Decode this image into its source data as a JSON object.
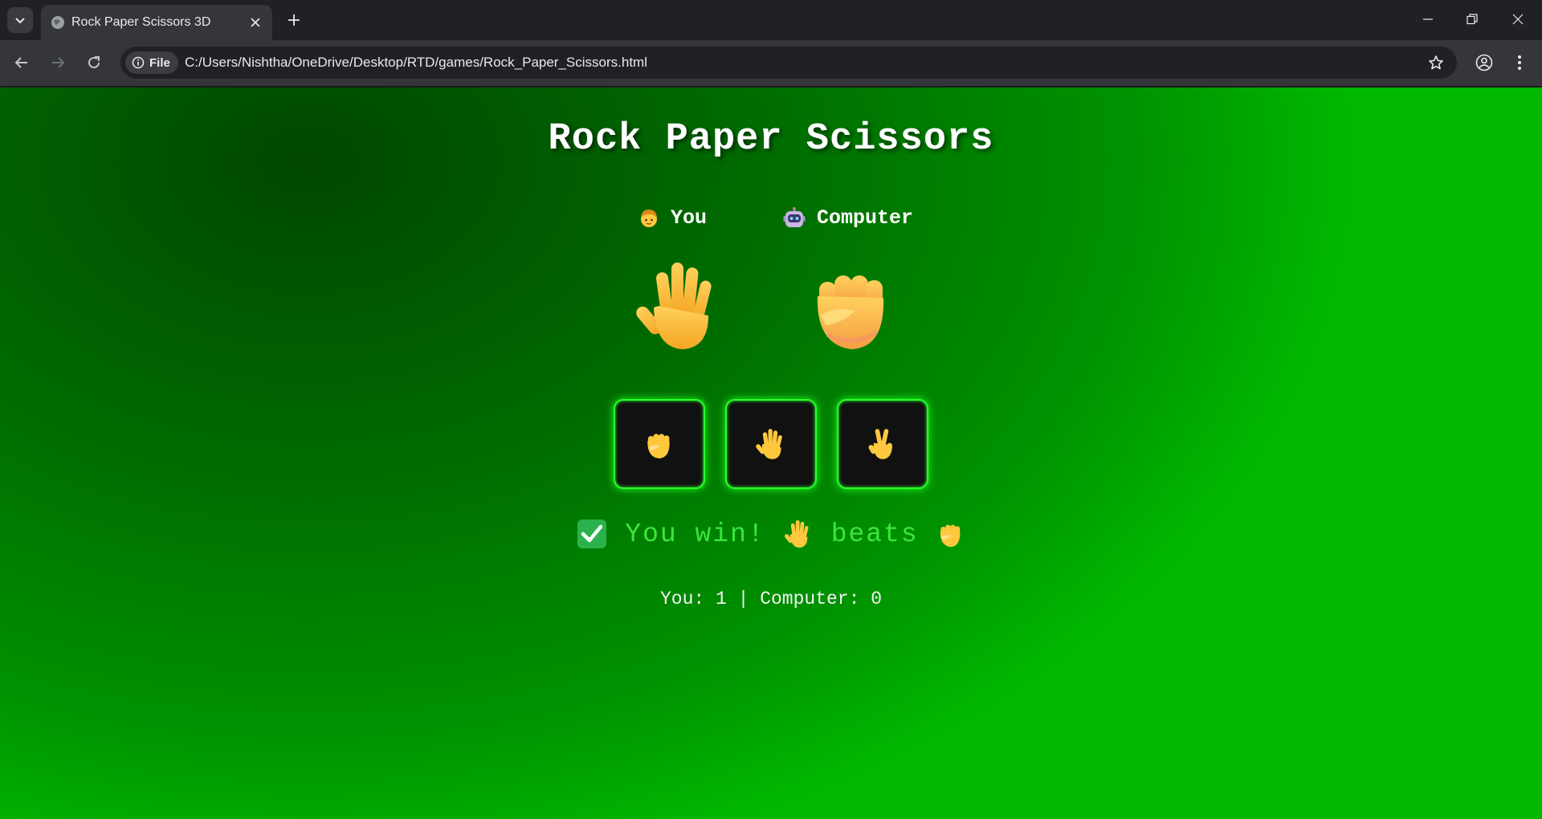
{
  "browser": {
    "tab_title": "Rock Paper Scissors 3D",
    "chip_label": "File",
    "url": "C:/Users/Nishtha/OneDrive/Desktop/RTD/games/Rock_Paper_Scissors.html"
  },
  "icons": {
    "tab_search": "chevron-down-icon",
    "favicon": "globe-icon",
    "close": "close-icon",
    "new_tab": "plus-icon",
    "back": "back-arrow-icon",
    "forward": "forward-arrow-icon",
    "reload": "reload-icon",
    "info": "info-icon",
    "bookmark": "star-icon",
    "profile": "profile-icon",
    "menu": "kebab-menu-icon"
  },
  "game": {
    "title": "Rock Paper Scissors",
    "player_label": "You",
    "player_icon": "person-emoji",
    "computer_label": "Computer",
    "computer_icon": "robot-emoji",
    "player_choice": "paper",
    "computer_choice": "rock",
    "choices": [
      "rock",
      "paper",
      "scissors"
    ],
    "result": {
      "icon": "check-mark-icon",
      "text_win": "You win!",
      "winner_hand": "paper",
      "text_beats": "beats",
      "loser_hand": "rock"
    },
    "score": "You: 1 | Computer: 0"
  },
  "colors": {
    "accent_green": "#2aff2a",
    "result_text": "#3ce63c",
    "skin": "#ffc83d",
    "button_bg": "#111111"
  }
}
